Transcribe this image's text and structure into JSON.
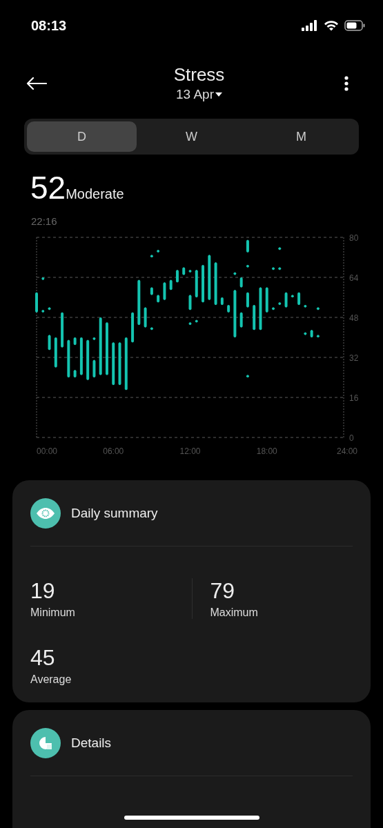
{
  "status_bar": {
    "time": "08:13"
  },
  "header": {
    "title": "Stress",
    "date": "13 Apr"
  },
  "period_tabs": [
    {
      "label": "D",
      "selected": true
    },
    {
      "label": "W",
      "selected": false
    },
    {
      "label": "M",
      "selected": false
    }
  ],
  "current": {
    "value": "52",
    "level_label": "Moderate",
    "time": "22:16"
  },
  "chart_data": {
    "type": "candlestick",
    "x": [
      0,
      0.5,
      1,
      1.5,
      2,
      2.5,
      3,
      3.5,
      4,
      4.5,
      5,
      5.5,
      6,
      6.5,
      7,
      7.5,
      8,
      8.5,
      9,
      9.5,
      10,
      10.5,
      11,
      11.5,
      12,
      12.5,
      13,
      13.5,
      14,
      14.5,
      15,
      15.5,
      16,
      16.5,
      17,
      17.5,
      18,
      18.5,
      19,
      19.5,
      20,
      20.5,
      21,
      21.5,
      22
    ],
    "xlim": [
      0,
      24
    ],
    "ylim": [
      0,
      80
    ],
    "xticks": [
      {
        "value": 0,
        "label": "00:00"
      },
      {
        "value": 6,
        "label": "06:00"
      },
      {
        "value": 12,
        "label": "12:00"
      },
      {
        "value": 18,
        "label": "18:00"
      },
      {
        "value": 24,
        "label": "24:00"
      }
    ],
    "yticks": [
      0,
      16,
      32,
      48,
      64,
      80
    ],
    "grid": true,
    "series": [
      {
        "color": "#14c4b0",
        "ohlc": [
          [
            50,
            58,
            50,
            58
          ],
          [
            50,
            51,
            50,
            51
          ],
          [
            35,
            41,
            35,
            41
          ],
          [
            28,
            40,
            28,
            40
          ],
          [
            36,
            50,
            36,
            50
          ],
          [
            24,
            39,
            24,
            39
          ],
          [
            37,
            40,
            37,
            40
          ],
          [
            25,
            40,
            25,
            40
          ],
          [
            23,
            39,
            23,
            39
          ],
          [
            24,
            31,
            24,
            31
          ],
          [
            25,
            48,
            25,
            48
          ],
          [
            25,
            46,
            25,
            46
          ],
          [
            21,
            38,
            21,
            38
          ],
          [
            21,
            38,
            21,
            38
          ],
          [
            19,
            40,
            19,
            40
          ],
          [
            38,
            50,
            38,
            50
          ],
          [
            45,
            63,
            45,
            63
          ],
          [
            44,
            52,
            44,
            52
          ],
          [
            57,
            60,
            57,
            60
          ],
          [
            54,
            57,
            54,
            57
          ],
          [
            55,
            62,
            55,
            62
          ],
          [
            59,
            63,
            59,
            63
          ],
          [
            62,
            67,
            62,
            67
          ],
          [
            65,
            68,
            65,
            68
          ],
          [
            51,
            57,
            51,
            57
          ],
          [
            56,
            67,
            56,
            67
          ],
          [
            54,
            69,
            54,
            69
          ],
          [
            55,
            73,
            55,
            73
          ],
          [
            53,
            70,
            53,
            70
          ],
          [
            53,
            56,
            53,
            56
          ],
          [
            50,
            53,
            50,
            53
          ],
          [
            40,
            59,
            40,
            59
          ],
          [
            44,
            50,
            44,
            50
          ],
          [
            52,
            58,
            52,
            58
          ],
          [
            43,
            53,
            43,
            53
          ],
          [
            43,
            60,
            43,
            60
          ],
          [
            50,
            60,
            50,
            60
          ],
          [
            51,
            52,
            51,
            52
          ],
          [
            53,
            54,
            53,
            54
          ],
          [
            52,
            58,
            52,
            58
          ],
          [
            56,
            57,
            56,
            57
          ],
          [
            53,
            58,
            53,
            58
          ],
          [
            52,
            53,
            52,
            53
          ],
          [
            40,
            43,
            40,
            43
          ],
          [
            40,
            41,
            40,
            41
          ]
        ]
      },
      {
        "color": "#14c4b0",
        "ohlc": [
          null,
          [
            63,
            64,
            63,
            64
          ],
          [
            51,
            52,
            51,
            52
          ],
          null,
          null,
          null,
          [
            24,
            27,
            24,
            27
          ],
          null,
          null,
          [
            39,
            40,
            39,
            40
          ],
          null,
          null,
          null,
          null,
          null,
          null,
          null,
          null,
          [
            72,
            73,
            72,
            73
          ],
          [
            74,
            75,
            74,
            75
          ],
          null,
          null,
          null,
          null,
          [
            66,
            67,
            66,
            67
          ],
          [
            46,
            47,
            46,
            47
          ],
          null,
          null,
          null,
          null,
          null,
          [
            65,
            66,
            65,
            66
          ],
          [
            60,
            64,
            60,
            64
          ],
          [
            74,
            79,
            74,
            79
          ],
          null,
          null,
          null,
          [
            67,
            68,
            67,
            68
          ],
          [
            75,
            76,
            75,
            76
          ],
          null,
          null,
          null,
          [
            41,
            42,
            41,
            42
          ],
          null,
          [
            51,
            52,
            51,
            52
          ]
        ]
      },
      {
        "color": "#14c4b0",
        "ohlc": [
          null,
          null,
          null,
          null,
          null,
          null,
          null,
          null,
          null,
          null,
          null,
          null,
          null,
          null,
          null,
          null,
          null,
          null,
          [
            43,
            44,
            43,
            44
          ],
          null,
          null,
          null,
          null,
          null,
          [
            45,
            46,
            45,
            46
          ],
          null,
          null,
          null,
          null,
          null,
          null,
          null,
          null,
          [
            68,
            69,
            68,
            69
          ],
          null,
          null,
          null,
          null,
          [
            67,
            68,
            67,
            68
          ],
          null,
          null,
          null,
          null,
          null,
          null
        ]
      },
      {
        "color": "#14c4b0",
        "ohlc": [
          null,
          null,
          null,
          null,
          null,
          null,
          null,
          null,
          null,
          null,
          null,
          null,
          null,
          null,
          null,
          null,
          null,
          null,
          null,
          null,
          null,
          null,
          null,
          null,
          null,
          null,
          null,
          null,
          null,
          null,
          null,
          null,
          null,
          [
            24,
            25,
            24,
            25
          ],
          null,
          null,
          null,
          null,
          null,
          null,
          null,
          null,
          null,
          null,
          null
        ]
      }
    ]
  },
  "summary": {
    "title": "Daily summary",
    "stats": [
      {
        "value": "19",
        "label": "Minimum"
      },
      {
        "value": "79",
        "label": "Maximum"
      },
      {
        "value": "45",
        "label": "Average"
      }
    ]
  },
  "details": {
    "title": "Details"
  }
}
